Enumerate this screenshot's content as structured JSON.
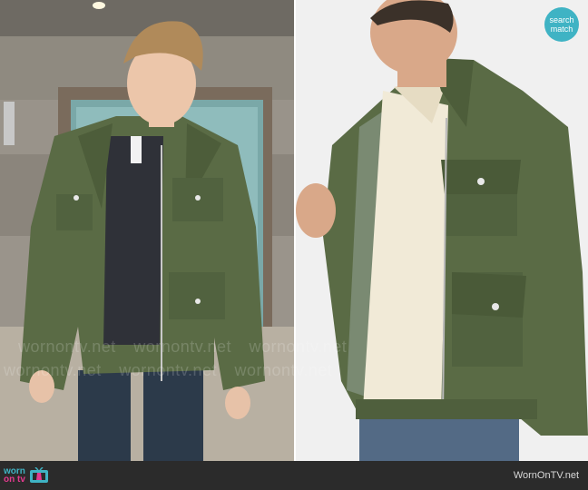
{
  "watermark": {
    "text": "wornontv.net"
  },
  "badge": {
    "line1": "search",
    "line2": "match"
  },
  "footer": {
    "logo_worn": "worn",
    "logo_ontv": "on tv",
    "site": "WornOnTV.net"
  },
  "colors": {
    "jacket_green": "#5a6b45",
    "badge_teal": "#3fb3c4",
    "footer_bg": "#2b2b2b",
    "logo_pink": "#e43a8f"
  }
}
